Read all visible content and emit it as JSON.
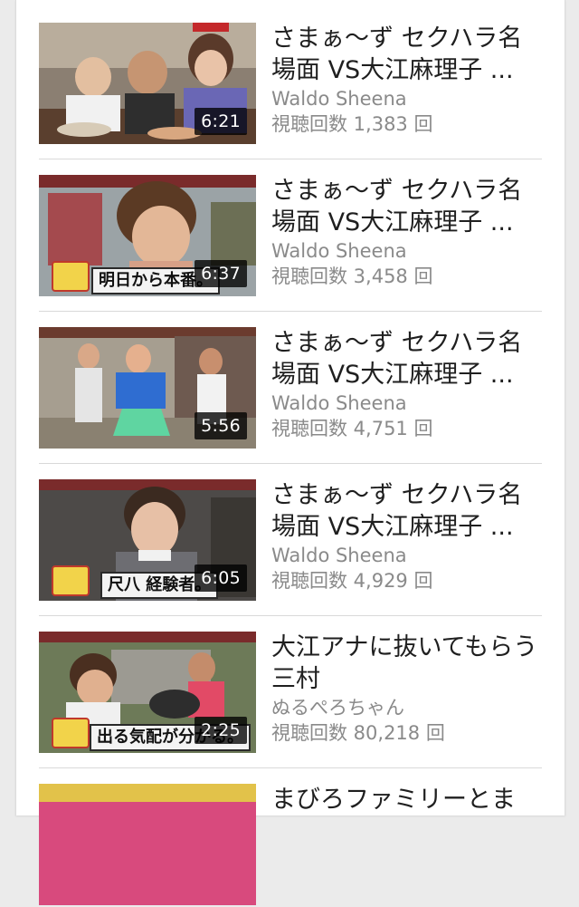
{
  "videos": [
    {
      "title": "さまぁ〜ず セクハラ名場面 VS大江麻理子 ...",
      "channel": "Waldo Sheena",
      "views": "視聴回数 1,383 回",
      "duration": "6:21",
      "caption": ""
    },
    {
      "title": "さまぁ〜ず セクハラ名場面 VS大江麻理子 ...",
      "channel": "Waldo Sheena",
      "views": "視聴回数 3,458 回",
      "duration": "6:37",
      "caption": "明日から本番。"
    },
    {
      "title": "さまぁ〜ず セクハラ名場面 VS大江麻理子 ...",
      "channel": "Waldo Sheena",
      "views": "視聴回数 4,751 回",
      "duration": "5:56",
      "caption": ""
    },
    {
      "title": "さまぁ〜ず セクハラ名場面 VS大江麻理子 ...",
      "channel": "Waldo Sheena",
      "views": "視聴回数 4,929 回",
      "duration": "6:05",
      "caption": "尺八 経験者。"
    },
    {
      "title": "大江アナに抜いてもらう三村",
      "channel": "ぬるぺろちゃん",
      "views": "視聴回数 80,218 回",
      "duration": "2:25",
      "caption": "出る気配が分かる。"
    },
    {
      "title": "まびろファミリーとま",
      "channel": "",
      "views": "",
      "duration": "",
      "caption": ""
    }
  ]
}
